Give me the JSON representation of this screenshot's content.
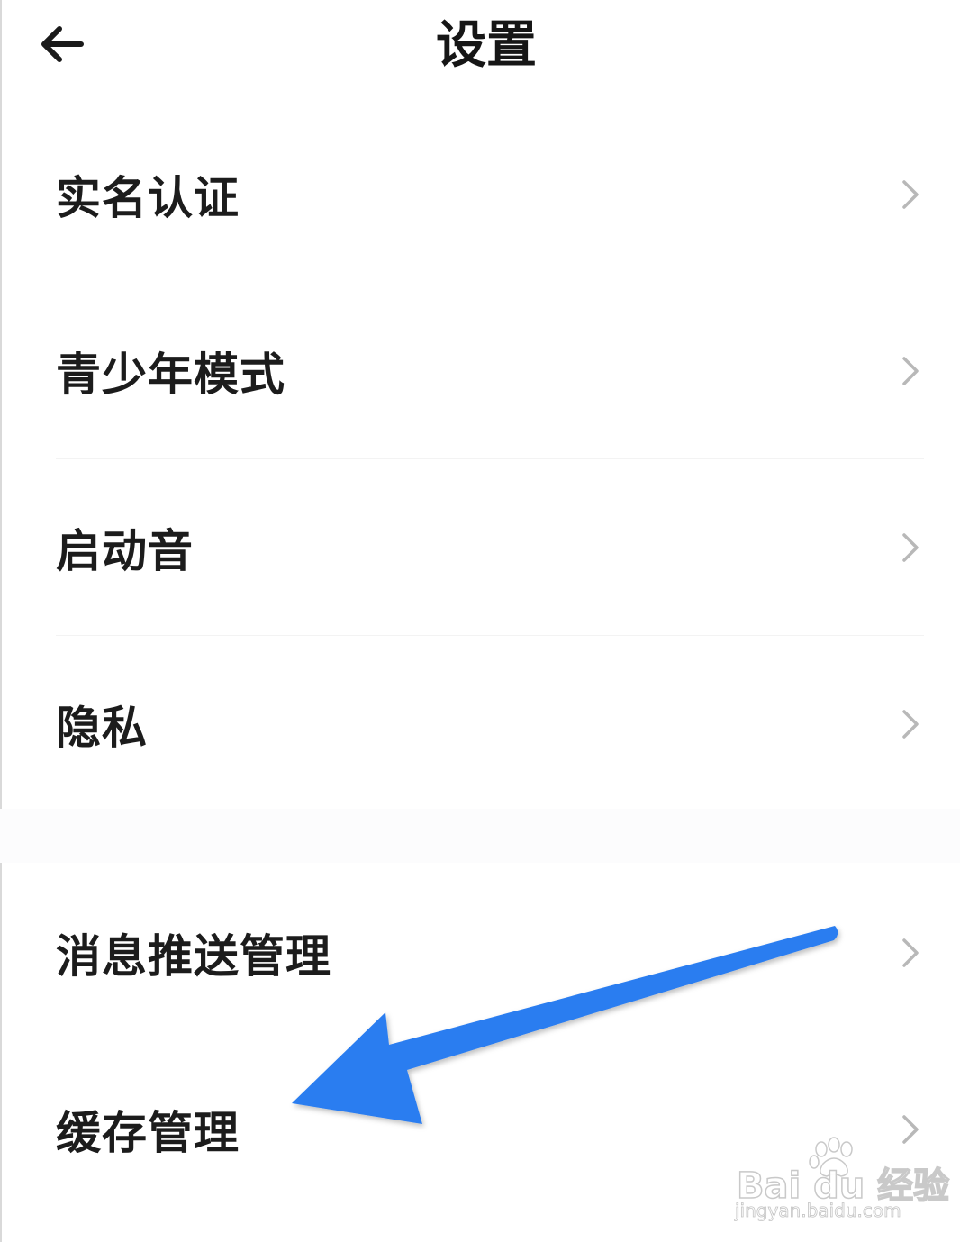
{
  "header": {
    "title": "设置",
    "back_icon": "arrow-left-icon"
  },
  "settings": {
    "items": [
      {
        "label": "实名认证",
        "icon": "chevron-right-icon"
      },
      {
        "label": "青少年模式",
        "icon": "chevron-right-icon"
      },
      {
        "label": "启动音",
        "icon": "chevron-right-icon"
      },
      {
        "label": "隐私",
        "icon": "chevron-right-icon"
      },
      {
        "label": "消息推送管理",
        "icon": "chevron-right-icon"
      },
      {
        "label": "缓存管理",
        "icon": "chevron-right-icon"
      }
    ]
  },
  "annotation": {
    "icon": "pointer-arrow-icon",
    "color": "#2a7df0"
  },
  "watermark": {
    "brand": "Bai du 经验",
    "url": "jingyan.baidu.com"
  },
  "colors": {
    "text": "#1c1c1c",
    "chevron": "#b8b8b8",
    "background": "#ffffff"
  }
}
